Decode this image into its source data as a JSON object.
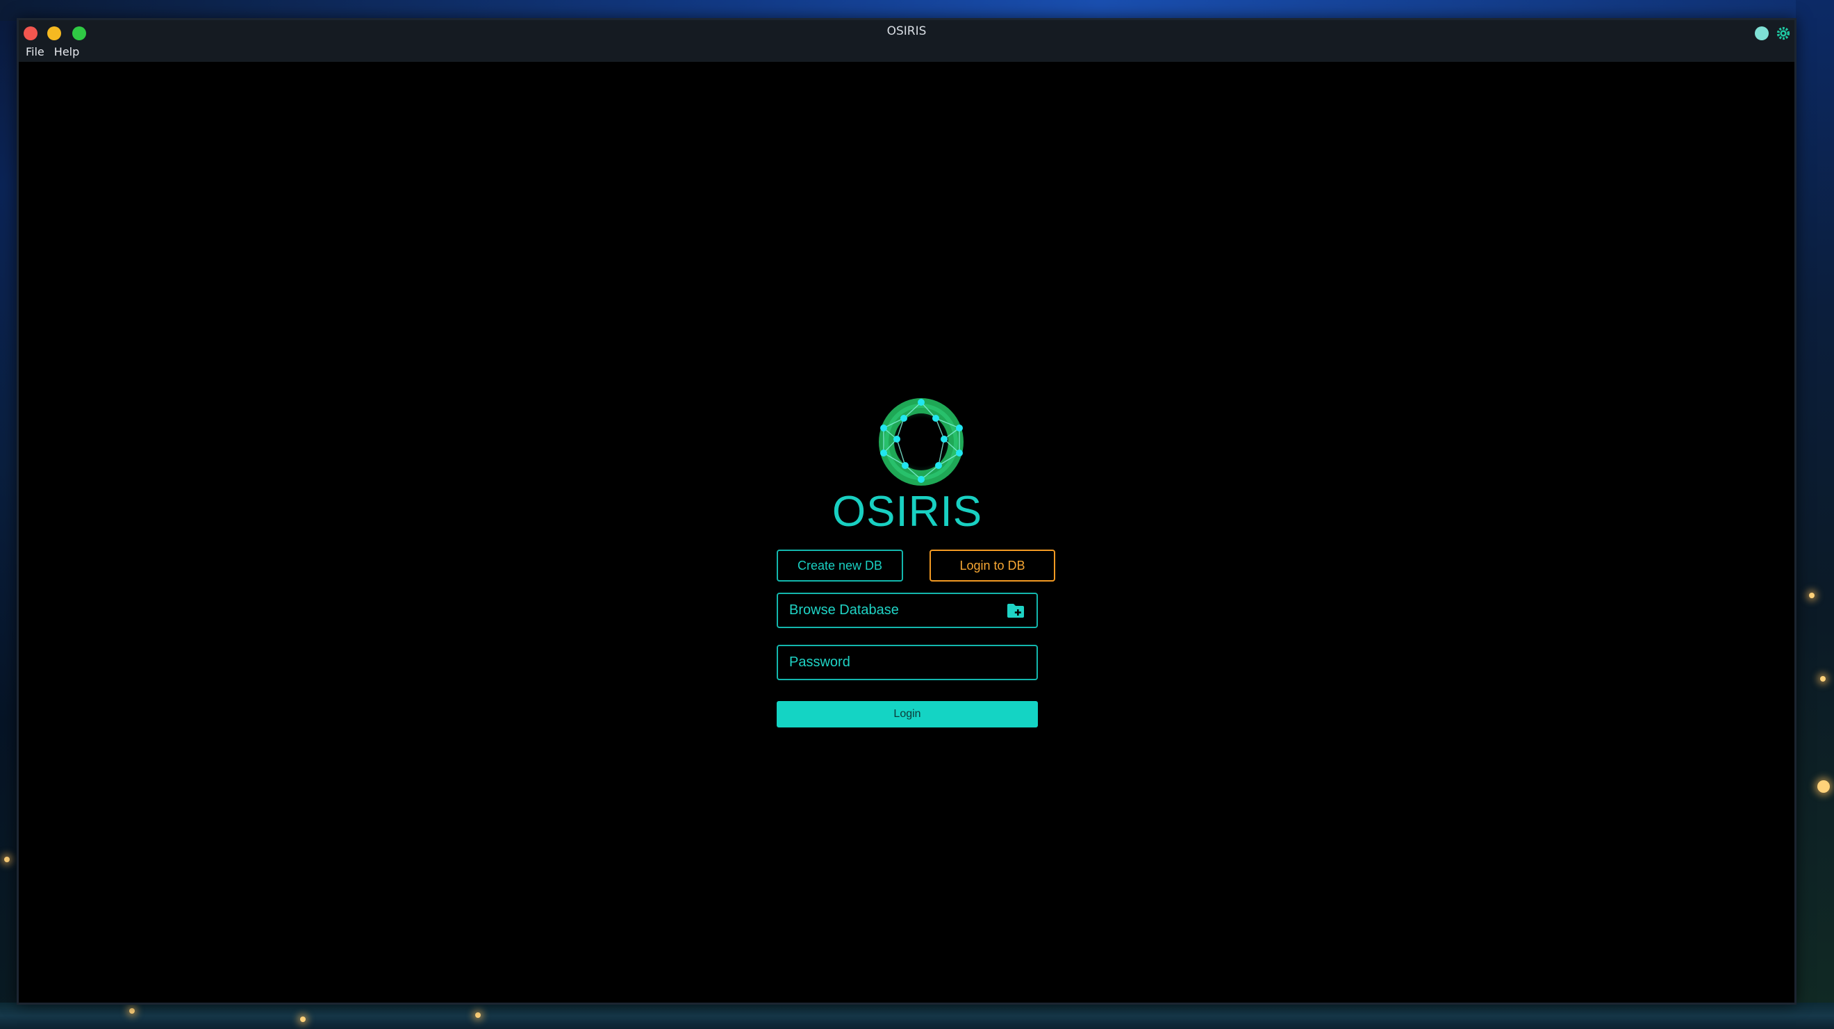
{
  "window": {
    "title": "OSIRIS"
  },
  "menubar": {
    "items": [
      {
        "label": "File"
      },
      {
        "label": "Help"
      }
    ]
  },
  "login": {
    "app_name": "OSIRIS",
    "create_db_label": "Create new DB",
    "login_db_label": "Login to DB",
    "browse_label": "Browse Database",
    "password_placeholder": "Password",
    "submit_label": "Login"
  },
  "icons": {
    "logo": "osiris-ring-logo",
    "browse": "folder-plus-icon",
    "titlebar_right": [
      "status-dot-icon",
      "gear-icon"
    ]
  },
  "colors": {
    "accent": "#14d4c4",
    "secondary": "#f39a23",
    "background": "#000000",
    "titlebar": "#151b22"
  }
}
